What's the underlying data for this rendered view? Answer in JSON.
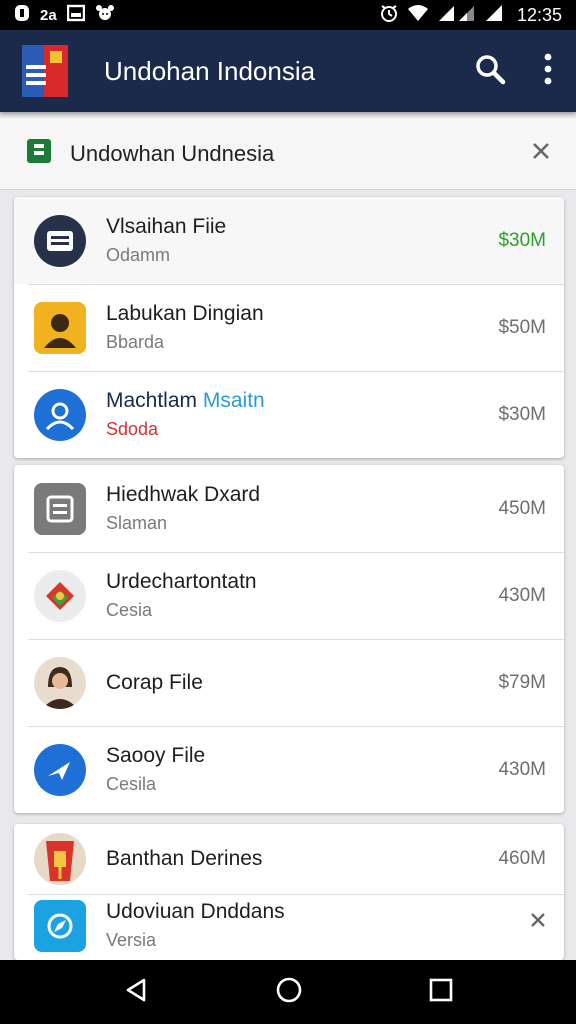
{
  "status_bar": {
    "left_text": "2a",
    "time": "12:35",
    "icons": [
      "notification-icon",
      "image-icon",
      "pet-icon",
      "alarm-icon",
      "wifi-icon",
      "signal-icon",
      "battery-icon"
    ]
  },
  "app_bar": {
    "title": "Undohan Indonsia",
    "icons": [
      "app-logo-icon",
      "search-icon",
      "overflow-menu-icon"
    ]
  },
  "banner": {
    "title": "Undowhan Undnesia",
    "icons": [
      "document-icon",
      "close-icon"
    ]
  },
  "groups": [
    {
      "items": [
        {
          "title": "Vlsaihan Fiie",
          "subtitle": "Odamm",
          "size": "$30M",
          "size_color": "#2aa02a",
          "icon": "document-avatar-icon"
        },
        {
          "title": "Labukan Dingian",
          "subtitle": "Bbarda",
          "size": "$50M",
          "icon": "person-silhouette-icon"
        },
        {
          "title": "Machtlam",
          "title_highlight": "Msaitn",
          "subtitle": "Sdoda",
          "subtitle_color": "#d93030",
          "size": "$30M",
          "icon": "user-avatar-icon"
        }
      ]
    },
    {
      "items": [
        {
          "title": "Hiedhwak Dxard",
          "subtitle": "Slaman",
          "size": "450M",
          "icon": "folder-icon"
        },
        {
          "title": "Urdechartontatn",
          "subtitle": "Cesia",
          "size": "430M",
          "icon": "badge-icon"
        },
        {
          "title": "Corap File",
          "subtitle": "",
          "size": "$79M",
          "icon": "woman-avatar-icon"
        },
        {
          "title": "Saooy File",
          "subtitle": "Cesila",
          "size": "430M",
          "icon": "plane-icon"
        }
      ]
    },
    {
      "items": [
        {
          "title": "Banthan Derines",
          "subtitle": "",
          "size": "460M",
          "icon": "shop-icon"
        },
        {
          "title": "Udoviuan Dnddans",
          "subtitle": "Versia",
          "size": "",
          "icon": "compass-icon"
        }
      ]
    }
  ],
  "nav_bar": {
    "icons": [
      "back-icon",
      "home-icon",
      "recents-icon"
    ]
  },
  "colors": {
    "app_bar": "#1b2a4a",
    "accent_blue": "#1e6fd6",
    "highlight_text": "#2a9bd8"
  }
}
